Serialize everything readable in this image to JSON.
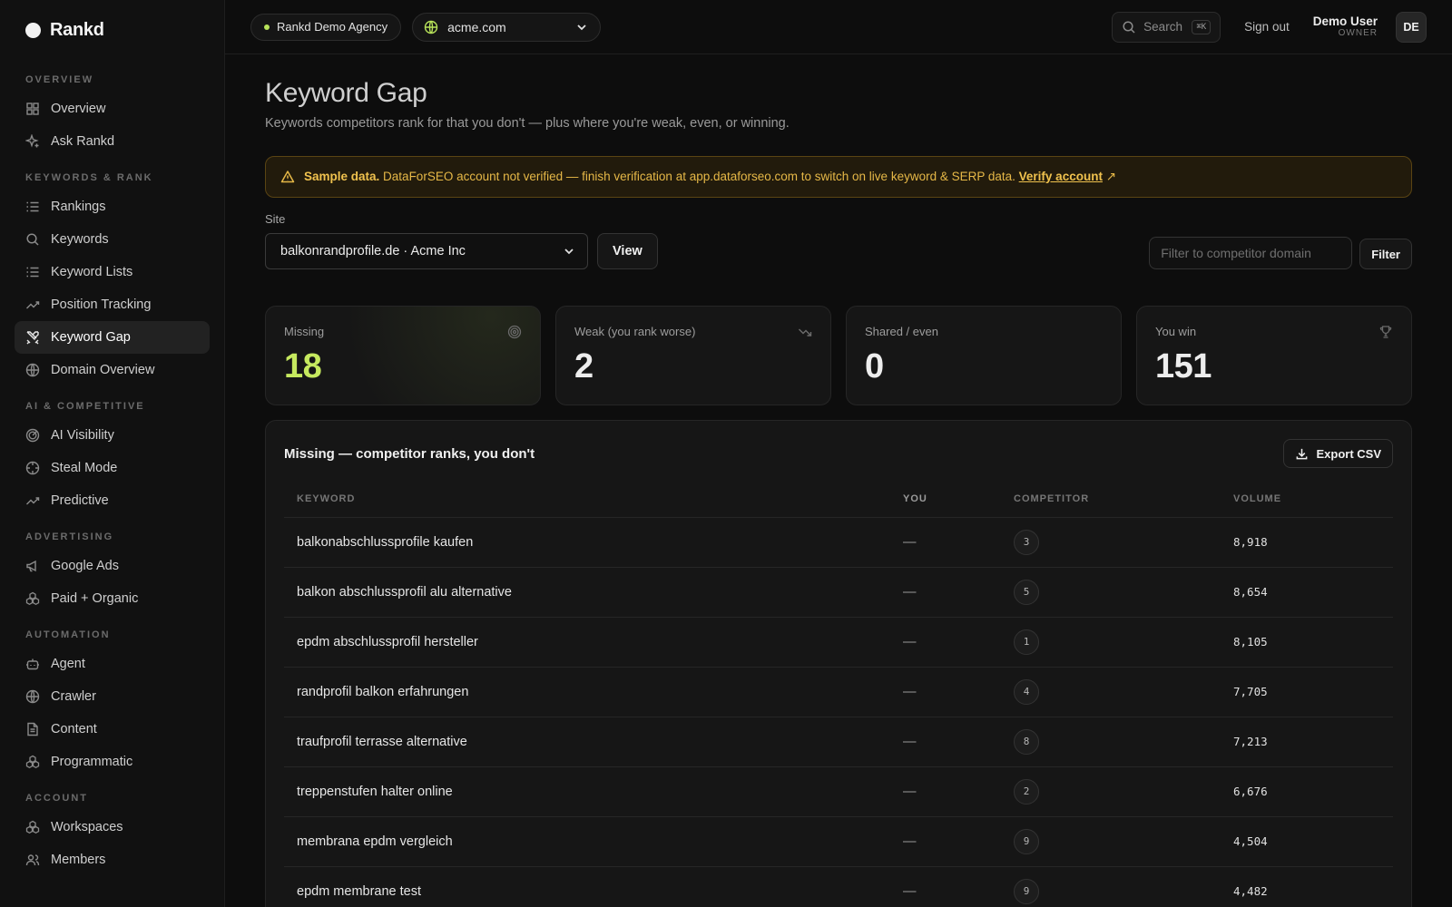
{
  "brand": {
    "name": "Rankd"
  },
  "sidebar": {
    "sections": [
      {
        "heading": "OVERVIEW",
        "items": [
          {
            "label": "Overview",
            "icon": "grid-icon"
          },
          {
            "label": "Ask Rankd",
            "icon": "sparkle-icon"
          }
        ]
      },
      {
        "heading": "KEYWORDS & RANK",
        "items": [
          {
            "label": "Rankings",
            "icon": "list-icon"
          },
          {
            "label": "Keywords",
            "icon": "search-icon"
          },
          {
            "label": "Keyword Lists",
            "icon": "list-icon"
          },
          {
            "label": "Position Tracking",
            "icon": "trend-up-icon"
          },
          {
            "label": "Keyword Gap",
            "icon": "swords-icon",
            "active": true
          },
          {
            "label": "Domain Overview",
            "icon": "globe-icon"
          }
        ]
      },
      {
        "heading": "AI & COMPETITIVE",
        "items": [
          {
            "label": "AI Visibility",
            "icon": "radar-icon"
          },
          {
            "label": "Steal Mode",
            "icon": "crosshair-icon"
          },
          {
            "label": "Predictive",
            "icon": "trend-up-icon"
          }
        ]
      },
      {
        "heading": "ADVERTISING",
        "items": [
          {
            "label": "Google Ads",
            "icon": "megaphone-icon"
          },
          {
            "label": "Paid + Organic",
            "icon": "boxes-icon"
          }
        ]
      },
      {
        "heading": "AUTOMATION",
        "items": [
          {
            "label": "Agent",
            "icon": "bot-icon"
          },
          {
            "label": "Crawler",
            "icon": "globe-icon"
          },
          {
            "label": "Content",
            "icon": "document-icon"
          },
          {
            "label": "Programmatic",
            "icon": "boxes-icon"
          }
        ]
      },
      {
        "heading": "ACCOUNT",
        "items": [
          {
            "label": "Workspaces",
            "icon": "boxes-icon"
          },
          {
            "label": "Members",
            "icon": "users-icon"
          }
        ]
      }
    ]
  },
  "topbar": {
    "agency": "Rankd Demo Agency",
    "domain": "acme.com",
    "search_label": "Search",
    "search_shortcut": "⌘K",
    "signout": "Sign out",
    "user_name": "Demo User",
    "user_role": "OWNER",
    "avatar_initials": "DE"
  },
  "page": {
    "title": "Keyword Gap",
    "subtitle": "Keywords competitors rank for that you don't — plus where you're weak, even, or winning."
  },
  "alert": {
    "strong": "Sample data.",
    "message": "DataForSEO account not verified — finish verification at app.dataforseo.com to switch on live keyword & SERP data.",
    "link": "Verify account",
    "link_arrow": "↗"
  },
  "filters": {
    "site_label": "Site",
    "site_value": "balkonrandprofile.de · Acme Inc",
    "view_button": "View",
    "competitor_placeholder": "Filter to competitor domain",
    "filter_button": "Filter"
  },
  "stats": [
    {
      "label": "Missing",
      "value": "18",
      "icon": "target-icon"
    },
    {
      "label": "Weak (you rank worse)",
      "value": "2",
      "icon": "trend-down-icon"
    },
    {
      "label": "Shared / even",
      "value": "0",
      "icon": ""
    },
    {
      "label": "You win",
      "value": "151",
      "icon": "trophy-icon"
    }
  ],
  "colors": {
    "accent": "#c6e95f",
    "warning": "#e6b847"
  },
  "table": {
    "title": "Missing — competitor ranks, you don't",
    "export_label": "Export CSV",
    "columns": [
      "KEYWORD",
      "YOU",
      "COMPETITOR",
      "VOLUME"
    ],
    "rows": [
      {
        "keyword": "balkonabschlussprofile kaufen",
        "you": "—",
        "competitor": "3",
        "volume": "8,918"
      },
      {
        "keyword": "balkon abschlussprofil alu alternative",
        "you": "—",
        "competitor": "5",
        "volume": "8,654"
      },
      {
        "keyword": "epdm abschlussprofil hersteller",
        "you": "—",
        "competitor": "1",
        "volume": "8,105"
      },
      {
        "keyword": "randprofil balkon erfahrungen",
        "you": "—",
        "competitor": "4",
        "volume": "7,705"
      },
      {
        "keyword": "traufprofil terrasse alternative",
        "you": "—",
        "competitor": "8",
        "volume": "7,213"
      },
      {
        "keyword": "treppenstufen halter online",
        "you": "—",
        "competitor": "2",
        "volume": "6,676"
      },
      {
        "keyword": "membrana epdm vergleich",
        "you": "—",
        "competitor": "9",
        "volume": "4,504"
      },
      {
        "keyword": "epdm membrane test",
        "you": "—",
        "competitor": "9",
        "volume": "4,482"
      }
    ]
  }
}
